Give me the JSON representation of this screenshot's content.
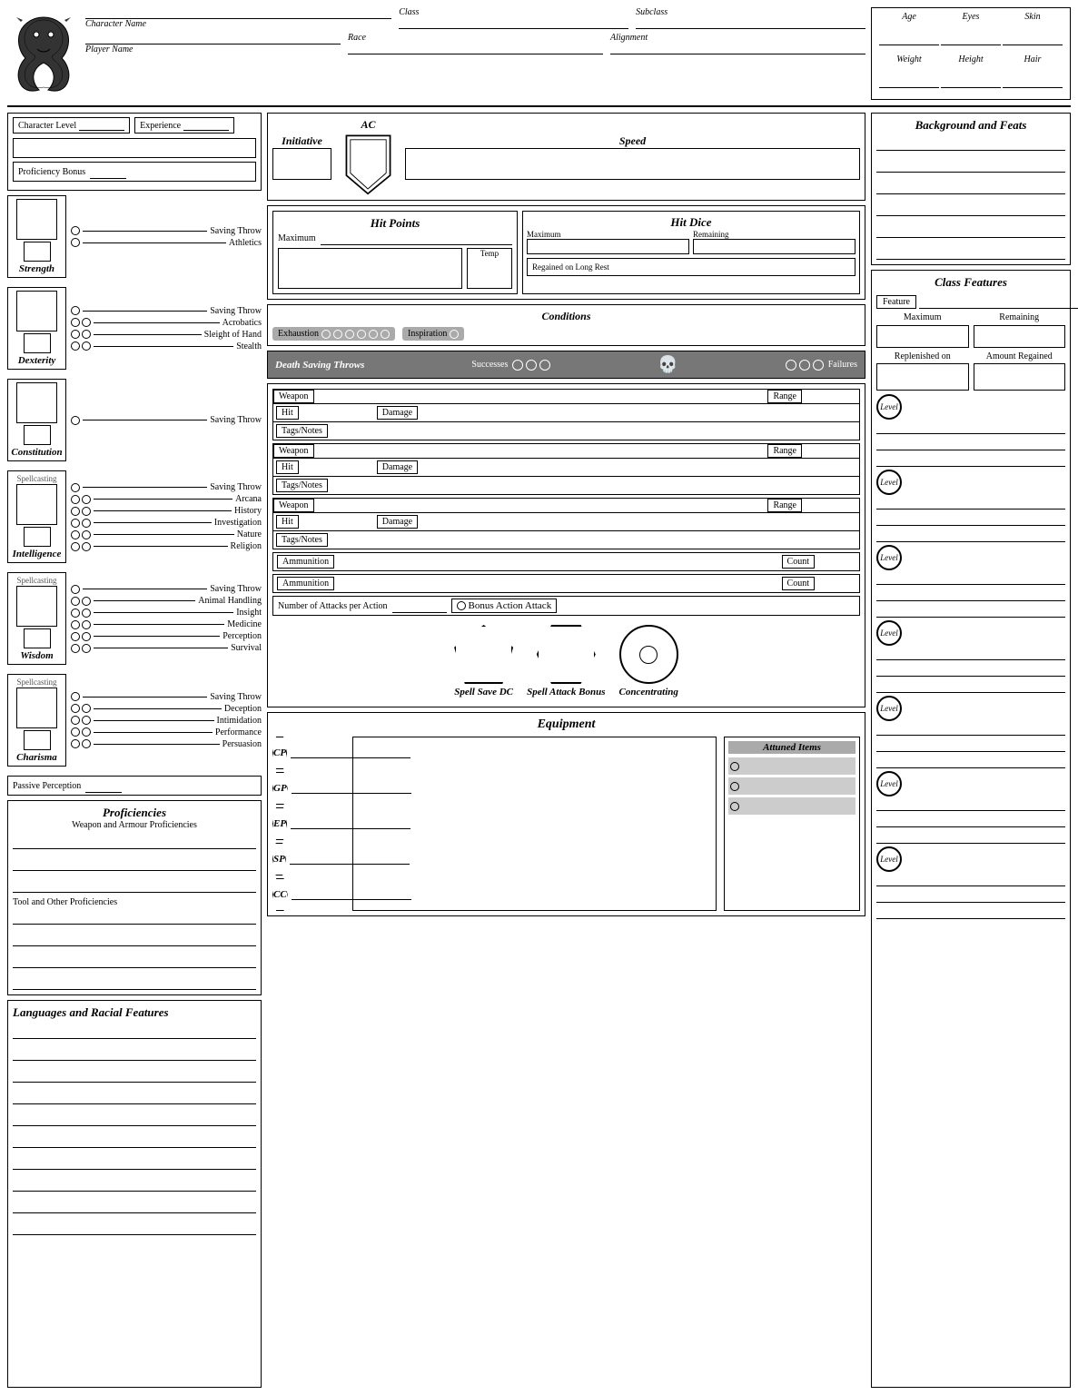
{
  "header": {
    "character_name_label": "Character Name",
    "player_name_label": "Player Name",
    "class_label": "Class",
    "subclass_label": "Subclass",
    "race_label": "Race",
    "alignment_label": "Alignment",
    "age_label": "Age",
    "eyes_label": "Eyes",
    "skin_label": "Skin",
    "weight_label": "Weight",
    "height_label": "Height",
    "hair_label": "Hair"
  },
  "top_left": {
    "character_level_label": "Character Level",
    "experience_label": "Experience",
    "proficiency_bonus_label": "Proficiency Bonus"
  },
  "abilities": {
    "strength": {
      "name": "Strength",
      "saving_throw_label": "Saving Throw",
      "athletics_label": "Athletics"
    },
    "dexterity": {
      "name": "Dexterity",
      "saving_throw_label": "Saving Throw",
      "acrobatics_label": "Acrobatics",
      "sleight_label": "Sleight of Hand",
      "stealth_label": "Stealth"
    },
    "constitution": {
      "name": "Constitution",
      "saving_throw_label": "Saving Throw"
    },
    "intelligence": {
      "name": "Intelligence",
      "spellcasting_label": "Spellcasting",
      "saving_throw_label": "Saving Throw",
      "arcana_label": "Arcana",
      "history_label": "History",
      "investigation_label": "Investigation",
      "nature_label": "Nature",
      "religion_label": "Religion"
    },
    "wisdom": {
      "name": "Wisdom",
      "spellcasting_label": "Spellcasting",
      "saving_throw_label": "Saving Throw",
      "animal_handling_label": "Animal Handling",
      "insight_label": "Insight",
      "medicine_label": "Medicine",
      "perception_label": "Perception",
      "survival_label": "Survival"
    },
    "charisma": {
      "name": "Charisma",
      "spellcasting_label": "Spellcasting",
      "saving_throw_label": "Saving Throw",
      "deception_label": "Deception",
      "intimidation_label": "Intimidation",
      "performance_label": "Performance",
      "persuasion_label": "Persuasion"
    }
  },
  "passive_perception_label": "Passive Perception",
  "combat": {
    "initiative_label": "Initiative",
    "ac_label": "AC",
    "speed_label": "Speed"
  },
  "hit_points": {
    "title": "Hit Points",
    "maximum_label": "Maximum",
    "temp_label": "Temp"
  },
  "hit_dice": {
    "title": "Hit Dice",
    "maximum_label": "Maximum",
    "remaining_label": "Remaining",
    "regained_label": "Regained on Long Rest"
  },
  "conditions": {
    "title": "Conditions",
    "exhaustion_label": "Exhaustion",
    "inspiration_label": "Inspiration"
  },
  "death_saves": {
    "title": "Death Saving Throws",
    "successes_label": "Successes",
    "failures_label": "Failures"
  },
  "weapons": {
    "weapon_label": "Weapon",
    "range_label": "Range",
    "hit_label": "Hit",
    "damage_label": "Damage",
    "tags_label": "Tags/Notes"
  },
  "ammunition": {
    "ammo_label": "Ammunition",
    "count_label": "Count"
  },
  "attacks": {
    "attacks_label": "Number of Attacks per Action",
    "bonus_attack_label": "Bonus Action Attack"
  },
  "spells": {
    "spell_save_label": "Spell Save DC",
    "spell_attack_label": "Spell Attack Bonus",
    "concentrating_label": "Concentrating"
  },
  "equipment": {
    "title": "Equipment",
    "currencies": [
      "CP",
      "GP",
      "EP",
      "SP",
      "CC"
    ],
    "attuned_title": "Attuned Items"
  },
  "proficiencies": {
    "title": "Proficiencies",
    "weapon_armour_label": "Weapon and Armour Proficiencies",
    "tool_other_label": "Tool and Other Proficiencies"
  },
  "languages": {
    "title": "Languages and Racial Features"
  },
  "background_feats": {
    "title": "Background and Feats"
  },
  "class_features": {
    "title": "Class Features",
    "feature_label": "Feature",
    "maximum_label": "Maximum",
    "remaining_label": "Remaining",
    "replenished_label": "Replenished on",
    "amount_regained_label": "Amount Regained",
    "level_label": "Level"
  }
}
